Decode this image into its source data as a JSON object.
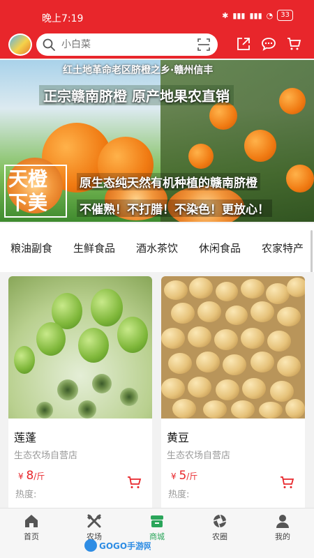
{
  "status": {
    "time": "晚上7:19",
    "battery": "33"
  },
  "search": {
    "placeholder": "小白菜"
  },
  "banner": {
    "top_line": "红土地革命老区脐橙之乡·赣州信丰",
    "headline": "正宗赣南脐橙  原产地果农直销",
    "calligraphy": "天橙下美",
    "line1": "原生态纯天然有机种植的赣南脐橙",
    "line2": "不催熟！不打腊！不染色！更放心！"
  },
  "categories": [
    "粮油副食",
    "生鲜食品",
    "酒水茶饮",
    "休闲食品",
    "农家特产"
  ],
  "products": [
    {
      "name": "莲蓬",
      "shop": "生态农场自营店",
      "currency": "¥",
      "price": "8",
      "unit": "/斤",
      "heat": "热度:"
    },
    {
      "name": "黄豆",
      "shop": "生态农场自营店",
      "currency": "¥",
      "price": "5",
      "unit": "/斤",
      "heat": "热度:"
    }
  ],
  "tabs": [
    {
      "label": "首页",
      "icon": "home-icon"
    },
    {
      "label": "农场",
      "icon": "farm-tools-icon"
    },
    {
      "label": "商城",
      "icon": "mall-icon"
    },
    {
      "label": "农圈",
      "icon": "aperture-icon"
    },
    {
      "label": "我的",
      "icon": "person-icon"
    }
  ],
  "colors": {
    "brand_red": "#e8262b",
    "active_green": "#2aa55a"
  },
  "watermark": "GOGO手游网"
}
